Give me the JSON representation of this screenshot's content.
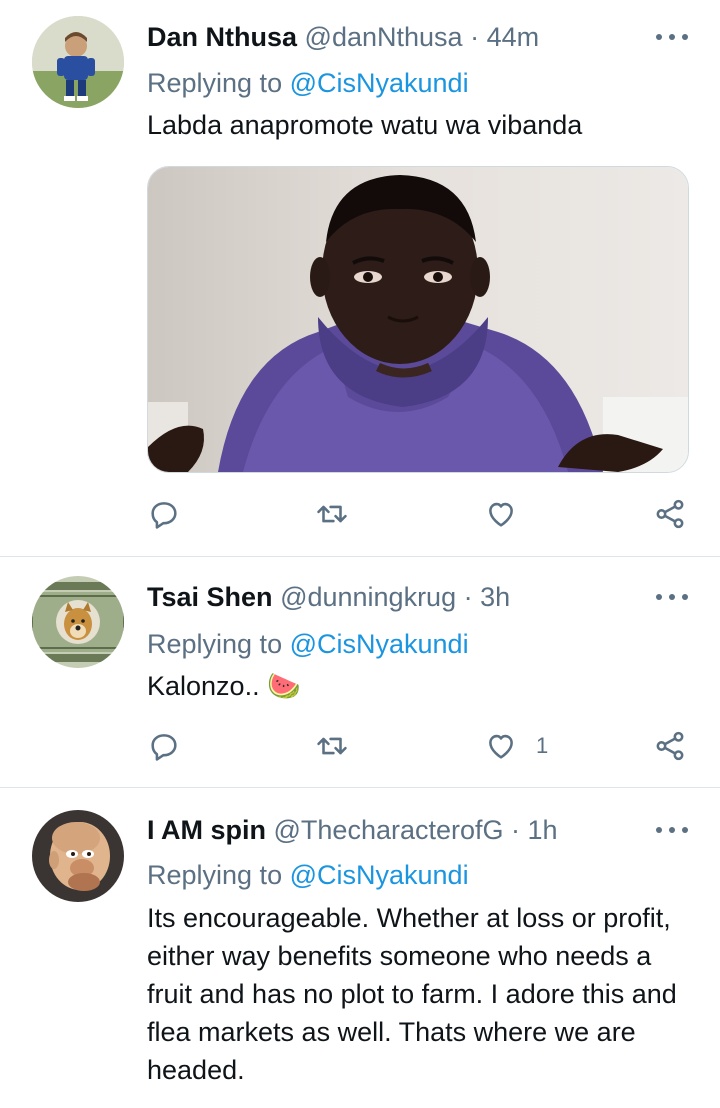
{
  "tweets": [
    {
      "name": "Dan Nthusa",
      "handle": "@danNthusa",
      "time": "· 44m",
      "replying_prefix": "Replying to",
      "replying_to": "@CisNyakundi",
      "text": "Labda anapromote watu wa vibanda",
      "has_media": true,
      "like_count": ""
    },
    {
      "name": "Tsai Shen",
      "handle": "@dunningkrug",
      "time": "· 3h",
      "replying_prefix": "Replying to",
      "replying_to": "@CisNyakundi",
      "text": "Kalonzo.. 🍉",
      "like_count": "1"
    },
    {
      "name": "I AM spin",
      "handle": "@ThecharacterofG",
      "time": "· 1h",
      "replying_prefix": "Replying to",
      "replying_to": "@CisNyakundi",
      "text": "Its encourageable. Whether at loss or profit, either way benefits someone who needs a fruit and has no plot to farm. I adore this and flea markets as well. Thats where we are headed."
    }
  ],
  "icons": {
    "reply": "reply-icon",
    "retweet": "retweet-icon",
    "like": "heart-icon",
    "share": "share-icon",
    "more": "more-icon"
  },
  "colors": {
    "link": "#1b95e0",
    "muted": "#5b7083",
    "divider": "#dfe4e8"
  }
}
